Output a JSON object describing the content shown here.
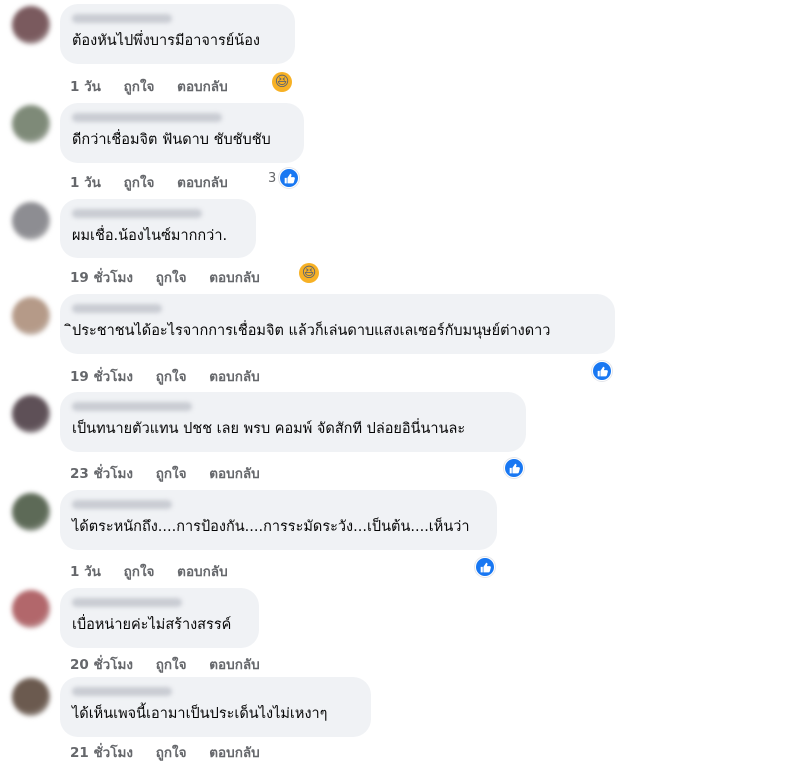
{
  "comments": [
    {
      "text": "ต้องหันไปพึ่งบารมีอาจารย์น้อง",
      "time": "1 วัน",
      "like_label": "ถูกใจ",
      "reply_label": "ตอบกลับ",
      "reaction": {
        "icon": "haha-icon",
        "count": ""
      },
      "avatar_color": "#7a5a5e"
    },
    {
      "text": "ดีกว่าเชื่อมจิต ฟันดาบ ชับชับชับ",
      "time": "1 วัน",
      "like_label": "ถูกใจ",
      "reply_label": "ตอบกลับ",
      "reaction": {
        "icon": "like-icon",
        "count": "3"
      },
      "avatar_color": "#7e8a78"
    },
    {
      "text": "ผมเชื่อ.น้องไนซ์มากกว่า.",
      "time": "19 ชั่วโมง",
      "like_label": "ถูกใจ",
      "reply_label": "ตอบกลับ",
      "reaction": {
        "icon": "haha-icon",
        "count": ""
      },
      "avatar_color": "#8d8d92"
    },
    {
      "text": "ิประชาชนได้อะไรจากการเชื่อมจิต แล้วก็เล่นดาบแสงเลเซอร์กับมนุษย์ต่างดาว",
      "time": "19 ชั่วโมง",
      "like_label": "ถูกใจ",
      "reply_label": "ตอบกลับ",
      "reaction": {
        "icon": "like-icon",
        "count": ""
      },
      "avatar_color": "#b59a88"
    },
    {
      "text": "เป็นทนายตัวแทน ปชช เลย พรบ คอมพ์ จัดสักที ปล่อยอินี่นานละ",
      "time": "23 ชั่วโมง",
      "like_label": "ถูกใจ",
      "reply_label": "ตอบกลับ",
      "reaction": {
        "icon": "like-icon",
        "count": ""
      },
      "avatar_color": "#5e5057"
    },
    {
      "text": "ได้ตระหนักถึง....การป้องกัน....การระมัดระวัง...เป็นต้น....เห็นว่า",
      "time": "1 วัน",
      "like_label": "ถูกใจ",
      "reply_label": "ตอบกลับ",
      "reaction": {
        "icon": "like-icon",
        "count": ""
      },
      "avatar_color": "#5d6a57"
    },
    {
      "text": "เบื่อหน่ายค่ะไม่สร้างสรรค์",
      "time": "20 ชั่วโมง",
      "like_label": "ถูกใจ",
      "reply_label": "ตอบกลับ",
      "reaction": null,
      "avatar_color": "#b2676b"
    },
    {
      "text": "ได้เห็นเพจนี้เอามาเป็นประเด็นไงไม่เหงาๆ",
      "time": "21 ชั่วโมง",
      "like_label": "ถูกใจ",
      "reply_label": "ตอบกลับ",
      "reaction": null,
      "avatar_color": "#6b5a4f"
    }
  ]
}
